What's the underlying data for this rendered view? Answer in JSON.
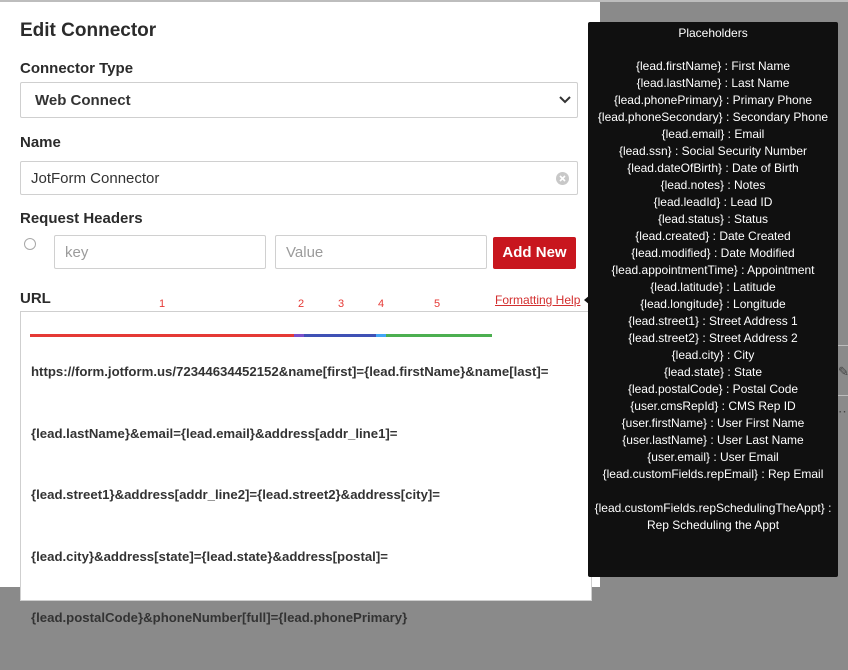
{
  "modal": {
    "title": "Edit Connector",
    "connector_type": {
      "label": "Connector Type",
      "selected": "Web Connect"
    },
    "name": {
      "label": "Name",
      "value": "JotForm Connector"
    },
    "headers": {
      "label": "Request Headers",
      "key_placeholder": "key",
      "value_placeholder": "Value",
      "add_button": "Add New"
    },
    "url": {
      "label": "URL",
      "formatting_help": "Formatting Help",
      "lines": [
        "https://form.jotform.us/72344634452152&name[first]={lead.firstName}&name[last]=",
        "{lead.lastName}&email={lead.email}&address[addr_line1]=",
        "{lead.street1}&address[addr_line2]={lead.street2}&address[city]=",
        "{lead.city}&address[state]={lead.state}&address[postal]=",
        "{lead.postalCode}&phoneNumber[full]={lead.phonePrimary}"
      ],
      "annotation_numbers": [
        "1",
        "2",
        "3",
        "4",
        "5"
      ],
      "annotation_colors": [
        "#e53935",
        "#7b4fc9",
        "#3f51b5",
        "#42a5f5",
        "#4caf50"
      ]
    }
  },
  "placeholders": {
    "title": "Placeholders",
    "items": [
      "{lead.firstName} : First Name",
      "{lead.lastName} : Last Name",
      "{lead.phonePrimary} : Primary Phone",
      "{lead.phoneSecondary} : Secondary Phone",
      "{lead.email} : Email",
      "{lead.ssn} : Social Security Number",
      "{lead.dateOfBirth} : Date of Birth",
      "{lead.notes} : Notes",
      "{lead.leadId} : Lead ID",
      "{lead.status} : Status",
      "{lead.created} : Date Created",
      "{lead.modified} : Date Modified",
      "{lead.appointmentTime} : Appointment",
      "{lead.latitude} : Latitude",
      "{lead.longitude} : Longitude",
      "{lead.street1} : Street Address 1",
      "{lead.street2} : Street Address 2",
      "{lead.city} : City",
      "{lead.state} : State",
      "{lead.postalCode} : Postal Code",
      "{user.cmsRepId} : CMS Rep ID",
      "{user.firstName} : User First Name",
      "{user.lastName} : User Last Name",
      "{user.email} : User Email",
      "{lead.customFields.repEmail} : Rep Email"
    ],
    "extra_item": "{lead.customFields.repSchedulingTheAppt} : Rep Scheduling the Appt"
  },
  "icons": {
    "select_chevron": "chevron-down-icon",
    "clear": "clear-icon",
    "background_edit": "pencil-icon",
    "background_more": "more-icon"
  }
}
